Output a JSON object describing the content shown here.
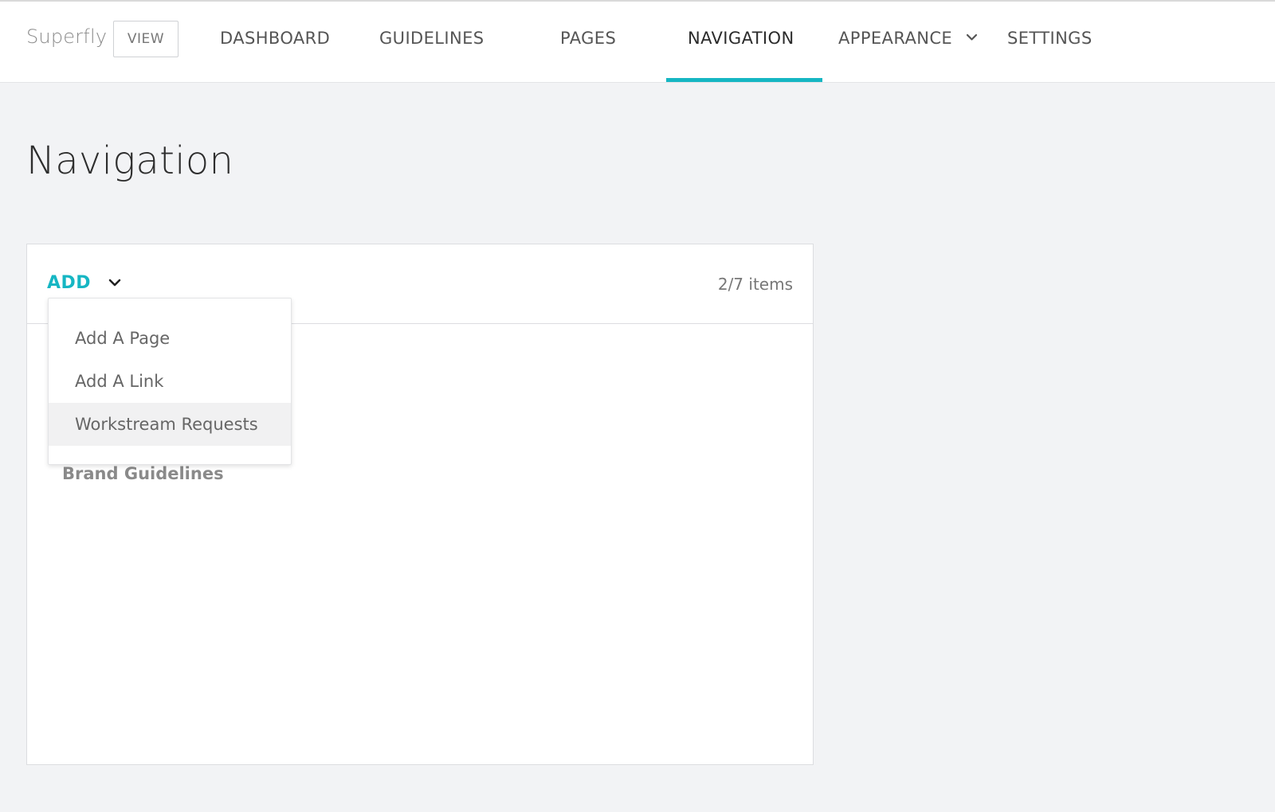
{
  "header": {
    "brand": "Superfly",
    "view_label": "VIEW",
    "nav": [
      {
        "label": "DASHBOARD"
      },
      {
        "label": "GUIDELINES"
      },
      {
        "label": "PAGES"
      },
      {
        "label": "NAVIGATION",
        "active": true
      },
      {
        "label": "APPEARANCE",
        "has_dropdown": true
      },
      {
        "label": "SETTINGS"
      }
    ]
  },
  "page": {
    "title": "Navigation"
  },
  "panel": {
    "add_label": "ADD",
    "count": "2/7 items",
    "items": [
      {
        "label": "Brand Guidelines"
      }
    ],
    "dropdown": {
      "open": true,
      "options": [
        {
          "label": "Add A Page"
        },
        {
          "label": "Add A Link"
        },
        {
          "label": "Workstream Requests",
          "highlighted": true
        }
      ]
    }
  },
  "colors": {
    "accent": "#16b6c3",
    "background": "#f2f3f5",
    "panel": "#ffffff"
  }
}
